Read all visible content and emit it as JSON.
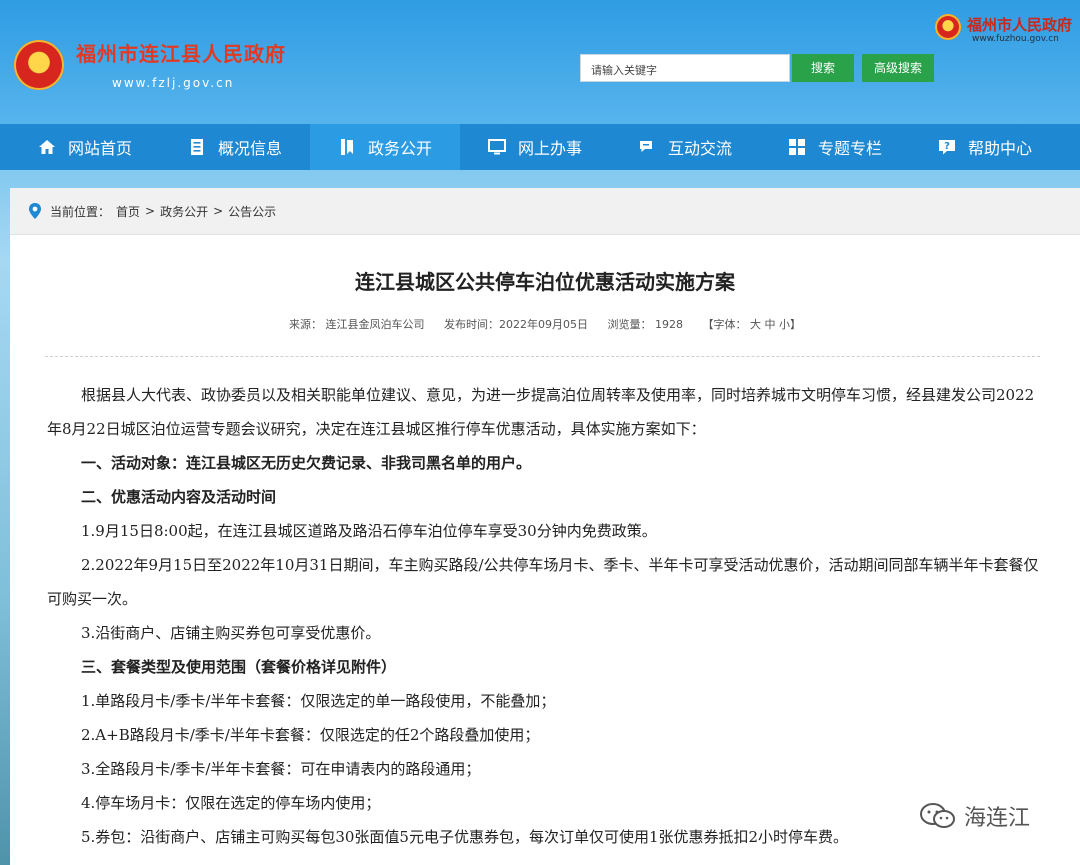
{
  "header": {
    "site_title": "福州市连江县人民政府",
    "site_url": "www.fzlj.gov.cn",
    "city_title": "福州市人民政府",
    "city_url": "www.fuzhou.gov.cn",
    "search_placeholder": "请输入关键字",
    "search_label": "搜索",
    "advanced_search_label": "高级搜索"
  },
  "nav": [
    {
      "label": "网站首页",
      "icon": "home-icon"
    },
    {
      "label": "概况信息",
      "icon": "document-icon"
    },
    {
      "label": "政务公开",
      "icon": "bookmark-icon",
      "active": true
    },
    {
      "label": "网上办事",
      "icon": "monitor-icon"
    },
    {
      "label": "互动交流",
      "icon": "chat-icon"
    },
    {
      "label": "专题专栏",
      "icon": "grid-icon"
    },
    {
      "label": "帮助中心",
      "icon": "help-icon"
    }
  ],
  "breadcrumb": {
    "prefix": "当前位置：",
    "items": [
      "首页",
      "政务公开",
      "公告公示"
    ],
    "sep": ">"
  },
  "article": {
    "title": "连江县城区公共停车泊位优惠活动实施方案",
    "source": "来源：  连江县金凤泊车公司",
    "date": "发布时间：2022年09月05日",
    "views": "浏览量：  1928",
    "font_size": "【字体：  大    中    小】",
    "paragraphs": [
      {
        "text": "根据县人大代表、政协委员以及相关职能单位建议、意见，为进一步提高泊位周转率及使用率，同时培养城市文明停车习惯，经县建发公司2022年8月22日城区泊位运营专题会议研究，决定在连江县城区推行停车优惠活动，具体实施方案如下：",
        "bold": false
      },
      {
        "text": "一、活动对象：连江县城区无历史欠费记录、非我司黑名单的用户。",
        "bold": true
      },
      {
        "text": "二、优惠活动内容及活动时间",
        "bold": true
      },
      {
        "text": "1.9月15日8:00起，在连江县城区道路及路沿石停车泊位停车享受30分钟内免费政策。",
        "bold": false
      },
      {
        "text": "2.2022年9月15日至2022年10月31日期间，车主购买路段/公共停车场月卡、季卡、半年卡可享受活动优惠价，活动期间同部车辆半年卡套餐仅可购买一次。",
        "bold": false
      },
      {
        "text": "3.沿街商户、店铺主购买券包可享受优惠价。",
        "bold": false
      },
      {
        "text": "三、套餐类型及使用范围（套餐价格详见附件）",
        "bold": true
      },
      {
        "text": "1.单路段月卡/季卡/半年卡套餐：仅限选定的单一路段使用，不能叠加；",
        "bold": false
      },
      {
        "text": "2.A+B路段月卡/季卡/半年卡套餐：仅限选定的任2个路段叠加使用；",
        "bold": false
      },
      {
        "text": "3.全路段月卡/季卡/半年卡套餐：可在申请表内的路段通用；",
        "bold": false
      },
      {
        "text": "4.停车场月卡：仅限在选定的停车场内使用；",
        "bold": false
      },
      {
        "text": "5.券包：沿街商户、店铺主可购买每包30张面值5元电子优惠券包，每次订单仅可使用1张优惠券抵扣2小时停车费。",
        "bold": false
      }
    ]
  },
  "watermark": "海连江",
  "colors": {
    "nav_bg": "#1e88d3",
    "nav_active": "#2b9be3",
    "search_btn": "#2aa24a",
    "title_red": "#e23a22"
  }
}
